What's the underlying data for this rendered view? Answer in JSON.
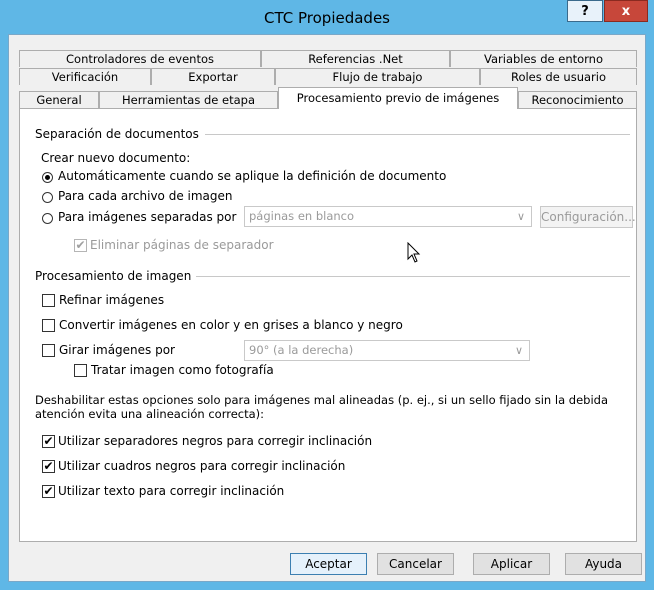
{
  "window": {
    "title": "CTC Propiedades",
    "help_label": "?",
    "close_label": "x"
  },
  "tabs": {
    "row1": [
      "Controladores de eventos",
      "Referencias .Net",
      "Variables de entorno"
    ],
    "row2": [
      "Verificación",
      "Exportar",
      "Flujo de trabajo",
      "Roles de usuario"
    ],
    "row3": [
      "General",
      "Herramientas de etapa",
      "Procesamiento previo de imágenes",
      "Reconocimiento"
    ],
    "active": "Procesamiento previo de imágenes"
  },
  "separation": {
    "group_label": "Separación de documentos",
    "create_label": "Crear nuevo documento:",
    "radio_auto": "Automáticamente cuando se aplique la definición de documento",
    "radio_each": "Para cada archivo de imagen",
    "radio_separated": "Para imágenes separadas por",
    "separated_select": "páginas en blanco",
    "config_button": "Configuración...",
    "remove_separator": "Eliminar páginas de separador"
  },
  "image_processing": {
    "group_label": "Procesamiento de imagen",
    "refine": "Refinar imágenes",
    "convert": "Convertir imágenes en color y en grises a blanco y negro",
    "rotate": "Girar imágenes por",
    "rotate_select": "90° (a la derecha)",
    "photo": "Tratar imagen como fotografía"
  },
  "deskew": {
    "description_line1": "Deshabilitar estas opciones solo para imágenes mal alineadas (p. ej., si un sello fijado sin la debida",
    "description_line2": "atención evita una alineación correcta):",
    "opt_black_separators": "Utilizar separadores negros para corregir inclinación",
    "opt_black_boxes": "Utilizar cuadros negros para corregir inclinación",
    "opt_text": "Utilizar texto para corregir inclinación",
    "check_mark": "✔"
  },
  "buttons": {
    "ok": "Aceptar",
    "cancel": "Cancelar",
    "apply": "Aplicar",
    "help": "Ayuda"
  }
}
